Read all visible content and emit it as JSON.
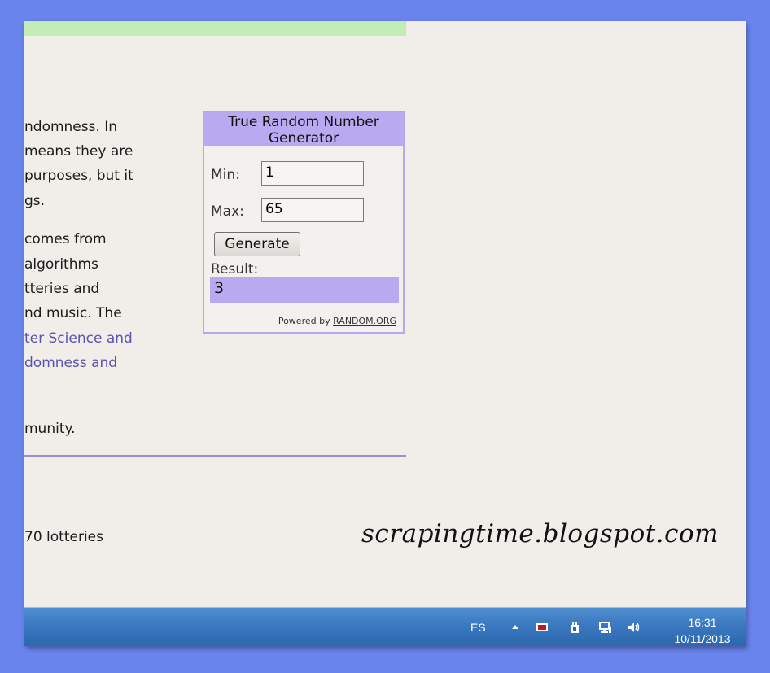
{
  "article": {
    "lines": [
      "ndomness. In",
      "means they are",
      "purposes, but it",
      "gs.",
      "comes from",
      "algorithms",
      "tteries and",
      "nd music. The",
      "ter Science and",
      "domness and",
      "munity.",
      "70 lotteries"
    ]
  },
  "widget": {
    "title_line1": "True Random Number",
    "title_line2": "Generator",
    "min_label": "Min:",
    "min_value": "1",
    "max_label": "Max:",
    "max_value": "65",
    "generate_label": "Generate",
    "result_label": "Result:",
    "result_value": "3",
    "powered_prefix": "Powered by ",
    "powered_link": "RANDOM.ORG"
  },
  "watermark": "scrapingtime.blogspot.com",
  "taskbar": {
    "language": "ES",
    "time": "16:31",
    "date": "10/11/2013",
    "icons": [
      "show-hidden-icons-arrow",
      "flag-icon",
      "power-plug-icon",
      "network-icon",
      "volume-icon"
    ]
  },
  "colors": {
    "background_border": "#6a84ee",
    "widget_accent": "#b8a9f0",
    "link": "#5a52b0",
    "green_bar": "#c4ecb6"
  }
}
